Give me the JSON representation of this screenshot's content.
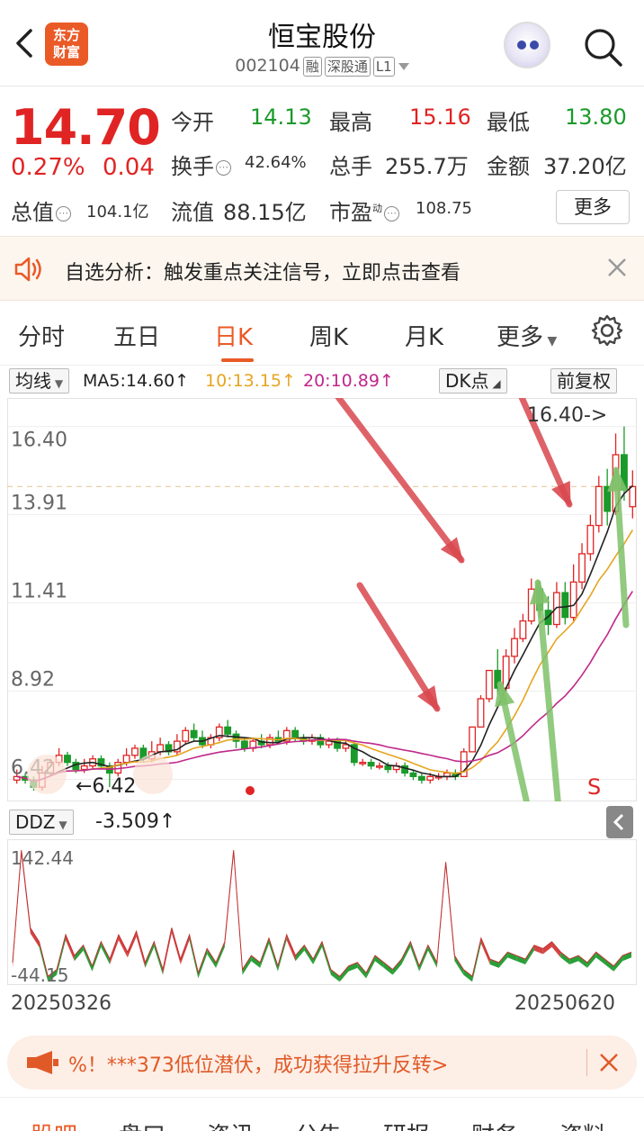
{
  "header": {
    "back_label": "返回",
    "logo_line1": "东方",
    "logo_line2": "财富",
    "title": "恒宝股份",
    "code": "002104",
    "tags": [
      "融",
      "深股通",
      "L1"
    ]
  },
  "quote": {
    "price": "14.70",
    "change_pct": "0.27%",
    "change": "0.04",
    "rows": [
      [
        {
          "label": "今开",
          "value": "14.13",
          "color": "#1a9a2a"
        },
        {
          "label": "最高",
          "value": "15.16",
          "color": "#e02424"
        },
        {
          "label": "最低",
          "value": "13.80",
          "color": "#1a9a2a"
        }
      ],
      [
        {
          "label": "换手",
          "value": "42.64%",
          "color": "#333333"
        },
        {
          "label": "总手",
          "value": "255.7万",
          "color": "#333333"
        },
        {
          "label": "金额",
          "value": "37.20亿",
          "color": "#333333"
        }
      ],
      [
        {
          "label": "总值",
          "value": "104.1亿",
          "color": "#333333"
        },
        {
          "label": "流值",
          "value": "88.15亿",
          "color": "#333333"
        },
        {
          "label": "市盈",
          "value": "108.75",
          "color": "#333333"
        }
      ]
    ],
    "pe_sup": "动",
    "more_label": "更多"
  },
  "notice": {
    "text": "自选分析：触发重点关注信号，立即点击查看"
  },
  "tabs": [
    "分时",
    "五日",
    "日K",
    "周K",
    "月K",
    "更多"
  ],
  "active_tab": "日K",
  "ma": {
    "selector": "均线",
    "ma5": "MA5:14.60↑",
    "ma10": "10:13.15↑",
    "ma20": "20:10.89↑",
    "dk_label": "DK点",
    "adjust_label": "前复权",
    "ma5_color": "#222222",
    "ma10_color": "#e6a520",
    "ma20_color": "#c0288a"
  },
  "chart": {
    "y_ticks": [
      "16.40",
      "13.91",
      "11.41",
      "8.92",
      "6.42"
    ],
    "high_marker": "16.40->",
    "low_marker": "6.42",
    "sell_mark": "S",
    "up_color": "#e02424",
    "down_color": "#1a9a2a"
  },
  "ddz": {
    "selector": "DDZ",
    "value": "-3.509↑",
    "top_label": "142.44",
    "bottom_label": "-44.15"
  },
  "dates": {
    "start": "20250326",
    "end": "20250620"
  },
  "ad": {
    "text": "%！***373低位潜伏，成功获得拉升反转>"
  },
  "bottom_tabs": [
    "股吧",
    "盘口",
    "资讯",
    "公告",
    "研报",
    "财务",
    "资料"
  ],
  "chart_data": {
    "type": "candlestick",
    "ylim": [
      6.0,
      17.0
    ],
    "ma5": 14.6,
    "ma10": 13.15,
    "ma20": 10.89,
    "candles": [
      {
        "o": 6.4,
        "c": 6.5,
        "h": 6.7,
        "l": 6.3
      },
      {
        "o": 6.5,
        "c": 6.4,
        "h": 6.6,
        "l": 6.3
      },
      {
        "o": 6.4,
        "c": 6.2,
        "h": 6.5,
        "l": 6.1
      },
      {
        "o": 6.2,
        "c": 6.6,
        "h": 6.8,
        "l": 6.1
      },
      {
        "o": 6.6,
        "c": 6.9,
        "h": 7.0,
        "l": 6.5
      },
      {
        "o": 6.9,
        "c": 7.1,
        "h": 7.3,
        "l": 6.8
      },
      {
        "o": 7.1,
        "c": 6.9,
        "h": 7.2,
        "l": 6.8
      },
      {
        "o": 6.9,
        "c": 6.7,
        "h": 7.0,
        "l": 6.6
      },
      {
        "o": 6.7,
        "c": 6.8,
        "h": 7.0,
        "l": 6.6
      },
      {
        "o": 6.8,
        "c": 7.0,
        "h": 7.1,
        "l": 6.7
      },
      {
        "o": 7.0,
        "c": 6.8,
        "h": 7.1,
        "l": 6.7
      },
      {
        "o": 6.8,
        "c": 6.6,
        "h": 6.9,
        "l": 6.2
      },
      {
        "o": 6.6,
        "c": 6.9,
        "h": 7.0,
        "l": 6.5
      },
      {
        "o": 6.9,
        "c": 7.1,
        "h": 7.3,
        "l": 6.8
      },
      {
        "o": 7.1,
        "c": 7.3,
        "h": 7.4,
        "l": 7.0
      },
      {
        "o": 7.3,
        "c": 7.0,
        "h": 7.4,
        "l": 6.9
      },
      {
        "o": 7.0,
        "c": 7.2,
        "h": 7.5,
        "l": 6.9
      },
      {
        "o": 7.2,
        "c": 7.4,
        "h": 7.6,
        "l": 7.1
      },
      {
        "o": 7.4,
        "c": 7.2,
        "h": 7.5,
        "l": 7.1
      },
      {
        "o": 7.2,
        "c": 7.5,
        "h": 7.7,
        "l": 7.1
      },
      {
        "o": 7.5,
        "c": 7.8,
        "h": 7.9,
        "l": 7.4
      },
      {
        "o": 7.8,
        "c": 7.6,
        "h": 8.0,
        "l": 7.5
      },
      {
        "o": 7.6,
        "c": 7.4,
        "h": 7.8,
        "l": 7.3
      },
      {
        "o": 7.4,
        "c": 7.6,
        "h": 7.7,
        "l": 7.3
      },
      {
        "o": 7.6,
        "c": 7.9,
        "h": 8.0,
        "l": 7.5
      },
      {
        "o": 7.9,
        "c": 7.7,
        "h": 8.1,
        "l": 7.6
      },
      {
        "o": 7.7,
        "c": 7.5,
        "h": 7.8,
        "l": 7.3
      },
      {
        "o": 7.5,
        "c": 7.3,
        "h": 7.6,
        "l": 7.2
      },
      {
        "o": 7.3,
        "c": 7.5,
        "h": 7.6,
        "l": 7.2
      },
      {
        "o": 7.5,
        "c": 7.4,
        "h": 7.7,
        "l": 7.3
      },
      {
        "o": 7.4,
        "c": 7.6,
        "h": 7.7,
        "l": 7.3
      },
      {
        "o": 7.6,
        "c": 7.5,
        "h": 7.8,
        "l": 7.4
      },
      {
        "o": 7.5,
        "c": 7.8,
        "h": 7.9,
        "l": 7.4
      },
      {
        "o": 7.8,
        "c": 7.6,
        "h": 7.9,
        "l": 7.5
      },
      {
        "o": 7.6,
        "c": 7.5,
        "h": 7.7,
        "l": 7.4
      },
      {
        "o": 7.5,
        "c": 7.6,
        "h": 7.7,
        "l": 7.4
      },
      {
        "o": 7.6,
        "c": 7.4,
        "h": 7.7,
        "l": 7.3
      },
      {
        "o": 7.4,
        "c": 7.5,
        "h": 7.6,
        "l": 7.3
      },
      {
        "o": 7.5,
        "c": 7.3,
        "h": 7.6,
        "l": 7.2
      },
      {
        "o": 7.3,
        "c": 7.4,
        "h": 7.5,
        "l": 7.2
      },
      {
        "o": 7.4,
        "c": 6.9,
        "h": 7.5,
        "l": 6.8
      },
      {
        "o": 6.9,
        "c": 6.9,
        "h": 7.0,
        "l": 6.8
      },
      {
        "o": 6.9,
        "c": 6.8,
        "h": 7.0,
        "l": 6.7
      },
      {
        "o": 6.8,
        "c": 6.8,
        "h": 6.9,
        "l": 6.7
      },
      {
        "o": 6.8,
        "c": 6.7,
        "h": 6.9,
        "l": 6.6
      },
      {
        "o": 6.7,
        "c": 6.8,
        "h": 6.9,
        "l": 6.6
      },
      {
        "o": 6.8,
        "c": 6.6,
        "h": 6.9,
        "l": 6.5
      },
      {
        "o": 6.6,
        "c": 6.5,
        "h": 6.7,
        "l": 6.4
      },
      {
        "o": 6.5,
        "c": 6.4,
        "h": 6.6,
        "l": 6.3
      },
      {
        "o": 6.4,
        "c": 6.5,
        "h": 6.6,
        "l": 6.3
      },
      {
        "o": 6.5,
        "c": 6.5,
        "h": 6.6,
        "l": 6.4
      },
      {
        "o": 6.5,
        "c": 6.6,
        "h": 6.7,
        "l": 6.4
      },
      {
        "o": 6.6,
        "c": 6.5,
        "h": 6.7,
        "l": 6.4
      },
      {
        "o": 6.5,
        "c": 7.2,
        "h": 7.3,
        "l": 6.5
      },
      {
        "o": 7.2,
        "c": 7.9,
        "h": 7.9,
        "l": 7.2
      },
      {
        "o": 7.9,
        "c": 8.7,
        "h": 8.8,
        "l": 7.9
      },
      {
        "o": 8.7,
        "c": 9.5,
        "h": 9.5,
        "l": 8.6
      },
      {
        "o": 9.5,
        "c": 9.0,
        "h": 10.1,
        "l": 8.8
      },
      {
        "o": 9.0,
        "c": 9.9,
        "h": 10.1,
        "l": 8.9
      },
      {
        "o": 9.9,
        "c": 10.4,
        "h": 10.7,
        "l": 9.7
      },
      {
        "o": 10.4,
        "c": 10.9,
        "h": 11.1,
        "l": 10.3
      },
      {
        "o": 10.9,
        "c": 11.8,
        "h": 12.1,
        "l": 10.8
      },
      {
        "o": 11.8,
        "c": 11.2,
        "h": 12.0,
        "l": 11.0
      },
      {
        "o": 11.2,
        "c": 10.8,
        "h": 11.6,
        "l": 10.5
      },
      {
        "o": 10.8,
        "c": 11.7,
        "h": 12.0,
        "l": 10.7
      },
      {
        "o": 11.7,
        "c": 11.0,
        "h": 12.0,
        "l": 10.8
      },
      {
        "o": 11.0,
        "c": 12.0,
        "h": 12.5,
        "l": 10.9
      },
      {
        "o": 12.0,
        "c": 12.8,
        "h": 13.1,
        "l": 11.8
      },
      {
        "o": 12.8,
        "c": 13.6,
        "h": 13.9,
        "l": 12.6
      },
      {
        "o": 13.6,
        "c": 14.7,
        "h": 15.0,
        "l": 13.4
      },
      {
        "o": 14.7,
        "c": 14.0,
        "h": 15.2,
        "l": 13.6
      },
      {
        "o": 14.0,
        "c": 15.6,
        "h": 16.2,
        "l": 13.9
      },
      {
        "o": 15.6,
        "c": 14.6,
        "h": 16.4,
        "l": 14.3
      },
      {
        "o": 14.13,
        "c": 14.7,
        "h": 15.16,
        "l": 13.8
      }
    ],
    "ddz": [
      -20,
      142,
      30,
      10,
      -40,
      -30,
      20,
      -10,
      5,
      -25,
      10,
      -15,
      20,
      -5,
      25,
      -20,
      10,
      -30,
      30,
      -15,
      20,
      -35,
      0,
      -20,
      10,
      142,
      -30,
      -10,
      -20,
      15,
      -25,
      20,
      -10,
      5,
      -15,
      10,
      -30,
      -40,
      -25,
      -20,
      -35,
      -10,
      -20,
      -30,
      -15,
      10,
      -25,
      5,
      -20,
      125,
      -10,
      -30,
      -40,
      15,
      -15,
      -20,
      -5,
      -10,
      -15,
      5,
      0,
      10,
      -5,
      -15,
      -10,
      -20,
      -5,
      -15,
      -25,
      -10,
      -5
    ]
  }
}
